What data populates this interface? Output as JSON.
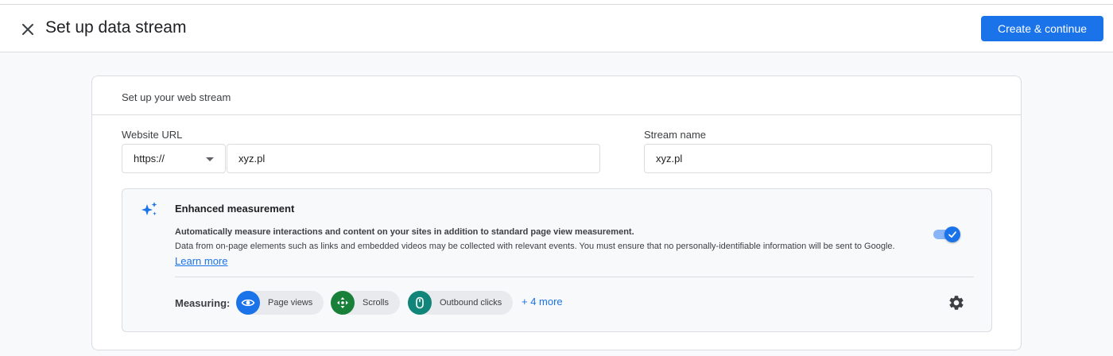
{
  "header": {
    "close_icon": "close-icon",
    "title": "Set up data stream",
    "primary_button": "Create & continue",
    "accent_color": "#1a73e8"
  },
  "card": {
    "heading": "Set up your web stream",
    "website_url": {
      "label": "Website URL",
      "protocol_selected": "https://",
      "value": "xyz.pl"
    },
    "stream_name": {
      "label": "Stream name",
      "value": "xyz.pl"
    },
    "enhanced_measurement": {
      "icon": "sparkle-icon",
      "title": "Enhanced measurement",
      "description_bold": "Automatically measure interactions and content on your sites in addition to standard page view measurement.",
      "description": "Data from on-page elements such as links and embedded videos may be collected with relevant events. You must ensure that no personally-identifiable information will be sent to Google.",
      "learn_more": "Learn more",
      "toggle_on": true,
      "measuring_label": "Measuring:",
      "chips": [
        {
          "label": "Page views",
          "icon": "eye-icon",
          "color": "#1a73e8"
        },
        {
          "label": "Scrolls",
          "icon": "scroll-icon",
          "color": "#188038"
        },
        {
          "label": "Outbound clicks",
          "icon": "mouse-icon",
          "color": "#12857a"
        }
      ],
      "more_link": "+ 4 more",
      "settings_icon": "gear-icon"
    }
  }
}
